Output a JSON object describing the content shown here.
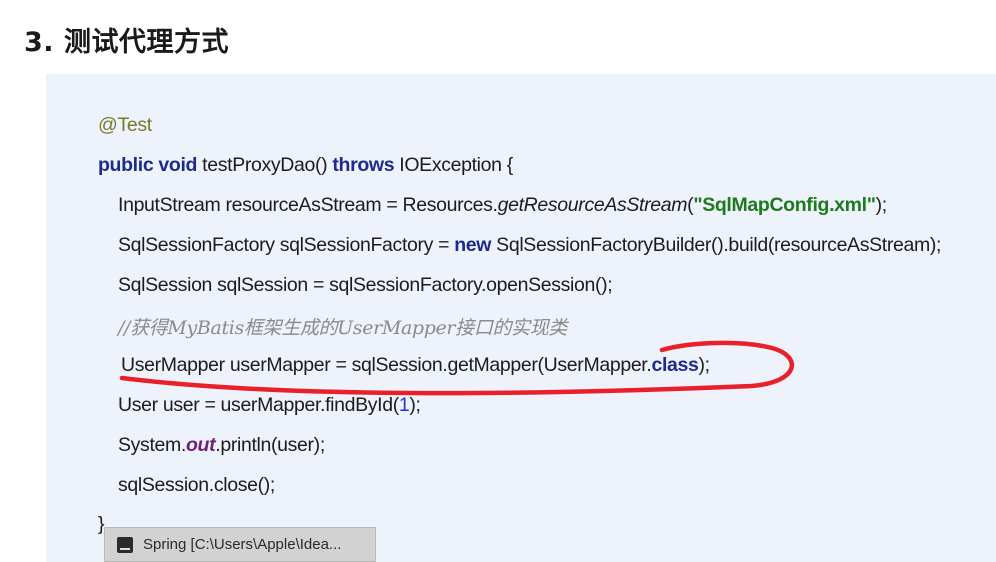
{
  "section_title": "3. 测试代理方式",
  "code": {
    "annotation": "@Test",
    "method": {
      "kw1": "public",
      "kw2": "void",
      "name": " testProxyDao() ",
      "kw3": "throws",
      "rest": " IOException {"
    },
    "line_stream": {
      "pre": "InputStream resourceAsStream = Resources.",
      "call": "getResourceAsStream",
      "open": "(",
      "str": "\"SqlMapConfig.xml\"",
      "close": ");"
    },
    "line_factory": {
      "pre": "SqlSessionFactory sqlSessionFactory = ",
      "kw": "new",
      "post": " SqlSessionFactoryBuilder().build(resourceAsStream);"
    },
    "line_session": "SqlSession sqlSession = sqlSessionFactory.openSession();",
    "comment": "//获得MyBatis框架生成的UserMapper接口的实现类",
    "line_mapper": {
      "pre": "UserMapper userMapper = sqlSession.getMapper(UserMapper.",
      "kw": "class",
      "post": ");"
    },
    "line_user": {
      "pre": "User user = userMapper.findById(",
      "num": "1",
      "post": ");"
    },
    "line_print": {
      "pre": "System.",
      "field": "out",
      "post": ".println(user);"
    },
    "line_close": "sqlSession.close();",
    "closing_brace": "}"
  },
  "taskbar": {
    "icon": "intellij-idea-icon",
    "label": "Spring [C:\\Users\\Apple\\Idea..."
  },
  "colors": {
    "panel_bg": "#eef2fa",
    "keyword": "#1e2a8c",
    "string": "#1d7a1d",
    "annotation_mark": "#e8202a"
  }
}
